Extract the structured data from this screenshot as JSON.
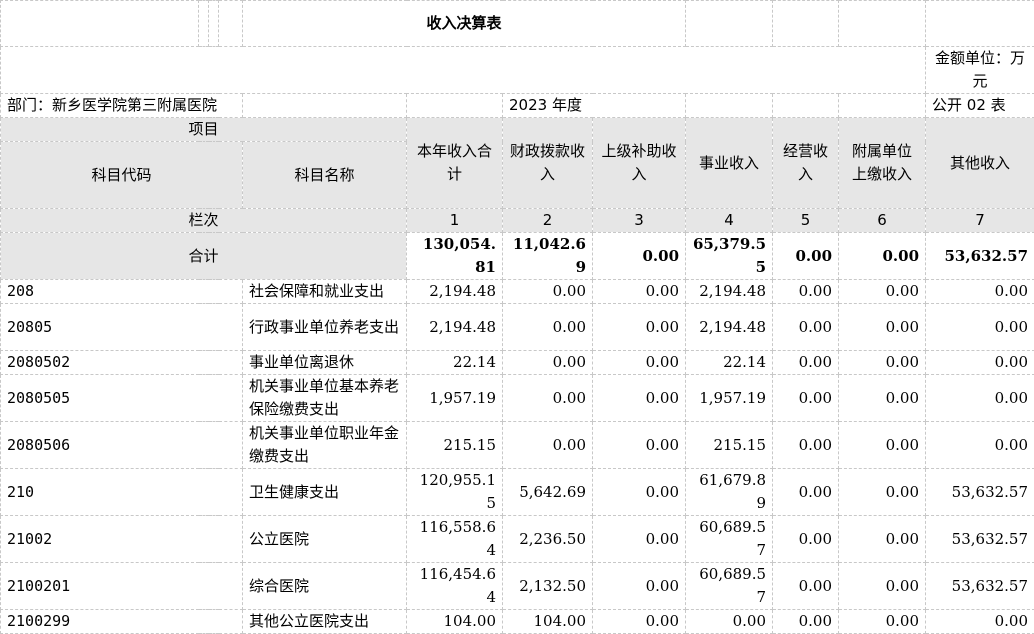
{
  "title": "收入决算表",
  "unit_label": "金额单位：万元",
  "dept_label": "部门：新乡医学院第三附属医院",
  "year_label": "2023 年度",
  "form_label": "公开 02 表",
  "headers": {
    "item": "项目",
    "code": "科目代码",
    "name": "科目名称",
    "total": "本年收入合计",
    "fiscal": "财政拨款收入",
    "upper": "上级补助收入",
    "business": "事业收入",
    "operating": "经营收入",
    "affiliate": "附属单位上缴收入",
    "other": "其他收入"
  },
  "col_row": {
    "label": "栏次",
    "nums": [
      "1",
      "2",
      "3",
      "4",
      "5",
      "6",
      "7"
    ]
  },
  "total_row": {
    "label": "合计",
    "values": [
      "130,054.81",
      "11,042.69",
      "0.00",
      "65,379.55",
      "0.00",
      "0.00",
      "53,632.57"
    ]
  },
  "rows": [
    {
      "code": "208",
      "name": "社会保障和就业支出",
      "values": [
        "2,194.48",
        "0.00",
        "0.00",
        "2,194.48",
        "0.00",
        "0.00",
        "0.00"
      ]
    },
    {
      "code": "20805",
      "name": "行政事业单位养老支出",
      "values": [
        "2,194.48",
        "0.00",
        "0.00",
        "2,194.48",
        "0.00",
        "0.00",
        "0.00"
      ]
    },
    {
      "code": "2080502",
      "name": "事业单位离退休",
      "values": [
        "22.14",
        "0.00",
        "0.00",
        "22.14",
        "0.00",
        "0.00",
        "0.00"
      ]
    },
    {
      "code": "2080505",
      "name": "机关事业单位基本养老保险缴费支出",
      "values": [
        "1,957.19",
        "0.00",
        "0.00",
        "1,957.19",
        "0.00",
        "0.00",
        "0.00"
      ]
    },
    {
      "code": "2080506",
      "name": "机关事业单位职业年金缴费支出",
      "values": [
        "215.15",
        "0.00",
        "0.00",
        "215.15",
        "0.00",
        "0.00",
        "0.00"
      ]
    },
    {
      "code": "210",
      "name": "卫生健康支出",
      "values": [
        "120,955.15",
        "5,642.69",
        "0.00",
        "61,679.89",
        "0.00",
        "0.00",
        "53,632.57"
      ]
    },
    {
      "code": "21002",
      "name": "公立医院",
      "values": [
        "116,558.64",
        "2,236.50",
        "0.00",
        "60,689.57",
        "0.00",
        "0.00",
        "53,632.57"
      ]
    },
    {
      "code": "2100201",
      "name": "综合医院",
      "values": [
        "116,454.64",
        "2,132.50",
        "0.00",
        "60,689.57",
        "0.00",
        "0.00",
        "53,632.57"
      ]
    },
    {
      "code": "2100299",
      "name": "其他公立医院支出",
      "values": [
        "104.00",
        "104.00",
        "0.00",
        "0.00",
        "0.00",
        "0.00",
        "0.00"
      ]
    }
  ]
}
